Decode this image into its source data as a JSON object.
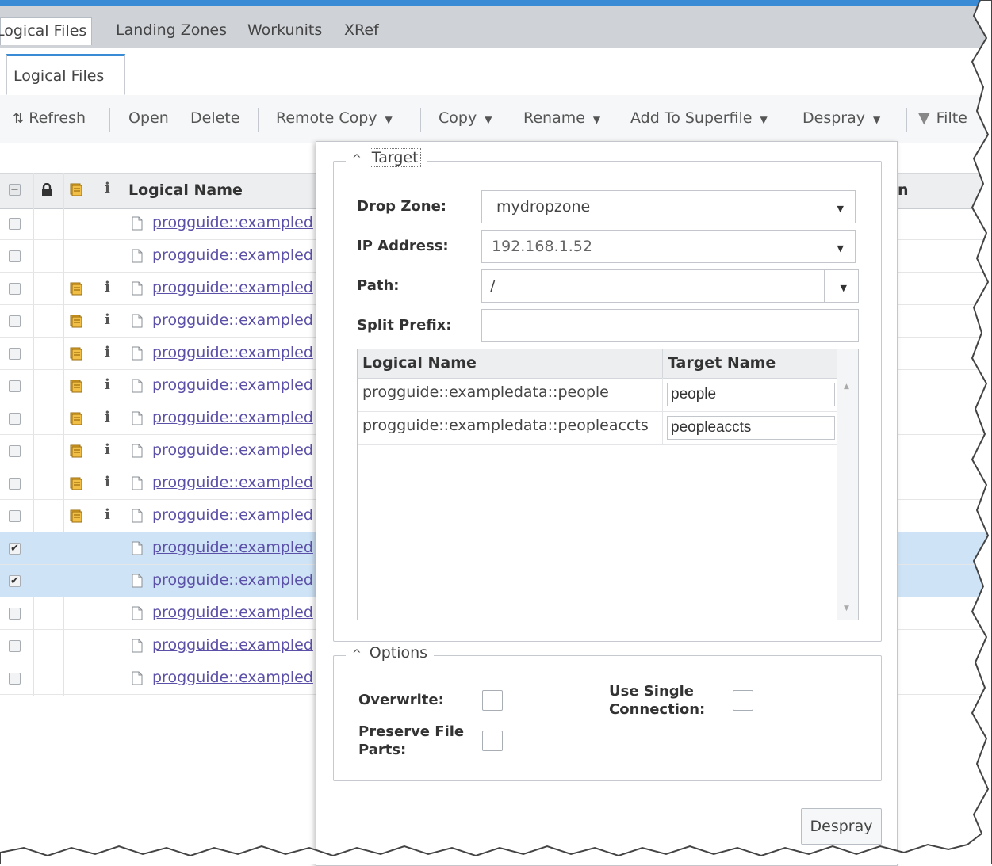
{
  "app_tabs": [
    "Logical Files",
    "Landing Zones",
    "Workunits",
    "XRef"
  ],
  "sub_tab": "Logical Files",
  "toolbar": {
    "refresh": "Refresh",
    "open": "Open",
    "delete": "Delete",
    "remote_copy": "Remote Copy",
    "copy": "Copy",
    "rename": "Rename",
    "add_to_superfile": "Add To Superfile",
    "despray": "Despray",
    "filter": "Filte"
  },
  "grid": {
    "header_logical_name": "Logical Name",
    "header_right_clip": "n",
    "rows": [
      {
        "name": "progguide::exampled",
        "checked": false,
        "stack": false,
        "info": false
      },
      {
        "name": "progguide::exampled",
        "checked": false,
        "stack": false,
        "info": false
      },
      {
        "name": "progguide::exampled",
        "checked": false,
        "stack": true,
        "info": true
      },
      {
        "name": "progguide::exampled",
        "checked": false,
        "stack": true,
        "info": true
      },
      {
        "name": "progguide::exampled",
        "checked": false,
        "stack": true,
        "info": true
      },
      {
        "name": "progguide::exampled",
        "checked": false,
        "stack": true,
        "info": true
      },
      {
        "name": "progguide::exampled",
        "checked": false,
        "stack": true,
        "info": true
      },
      {
        "name": "progguide::exampled",
        "checked": false,
        "stack": true,
        "info": true
      },
      {
        "name": "progguide::exampled",
        "checked": false,
        "stack": true,
        "info": true
      },
      {
        "name": "progguide::exampled",
        "checked": false,
        "stack": true,
        "info": true
      },
      {
        "name": "progguide::exampled",
        "checked": true,
        "stack": false,
        "info": false
      },
      {
        "name": "progguide::exampled",
        "checked": true,
        "stack": false,
        "info": false
      },
      {
        "name": "progguide::exampled",
        "checked": false,
        "stack": false,
        "info": false
      },
      {
        "name": "progguide::exampled",
        "checked": false,
        "stack": false,
        "info": false
      },
      {
        "name": "progguide::exampled",
        "checked": false,
        "stack": false,
        "info": false
      }
    ]
  },
  "despray_panel": {
    "target_legend": "Target",
    "drop_zone_label": "Drop  Zone:",
    "drop_zone_value": "mydropzone",
    "ip_label": "IP  Address:",
    "ip_value": "192.168.1.52",
    "path_label": "Path:",
    "path_value": "/",
    "split_prefix_label": "Split  Prefix:",
    "split_prefix_value": "",
    "table": {
      "headers": [
        "Logical Name",
        "Target Name"
      ],
      "rows": [
        {
          "logical": "progguide::exampledata::people",
          "target": "people"
        },
        {
          "logical": "progguide::exampledata::peopleaccts",
          "target": "peopleaccts"
        }
      ]
    },
    "options_legend": "Options",
    "overwrite_label": "Overwrite:",
    "use_single_connection_label": "Use Single Connection:",
    "preserve_file_parts_label": "Preserve File Parts:",
    "overwrite": false,
    "use_single_connection": false,
    "preserve_file_parts": false,
    "despray_button": "Despray"
  },
  "colors": {
    "accent": "#3a8bd6",
    "link": "#5b50a8",
    "selected_row": "#cfe3f6",
    "icon_stack": "#e2a628"
  }
}
